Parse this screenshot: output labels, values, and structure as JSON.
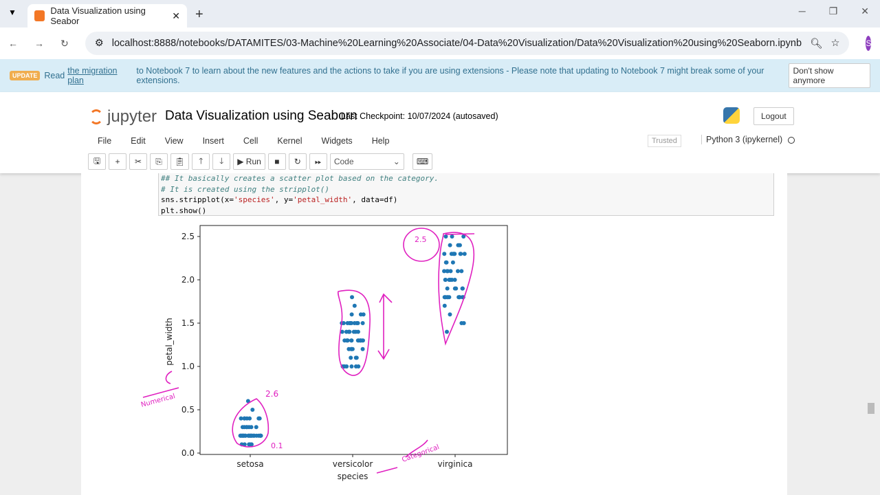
{
  "browser": {
    "tab_title": "Data Visualization using Seabor",
    "url": "localhost:8888/notebooks/DATAMITES/03-Machine%20Learning%20Associate/04-Data%20Visualization/Data%20Visualization%20using%20Seaborn.ipynb",
    "avatar": "S"
  },
  "banner": {
    "badge": "UPDATE",
    "pre": "Read",
    "link": "the migration plan",
    "post": "to Notebook 7 to learn about the new features and the actions to take if you are using extensions - Please note that updating to Notebook 7 might break some of your extensions.",
    "dismiss": "Don't show anymore"
  },
  "header": {
    "logo": "jupyter",
    "title": "Data Visualization using Seaborn",
    "checkpoint": "Last Checkpoint: 10/07/2024  (autosaved)",
    "logout": "Logout",
    "trusted": "Trusted",
    "kernel": "Python 3 (ipykernel)"
  },
  "menu": [
    "File",
    "Edit",
    "View",
    "Insert",
    "Cell",
    "Kernel",
    "Widgets",
    "Help"
  ],
  "toolbar": {
    "run": "Run",
    "cell_type": "Code"
  },
  "code": {
    "line1": "## It basically creates a scatter plot based on the category.",
    "line2": "# It is created using the stripplot()",
    "l3a": "sns.stripplot(x=",
    "l3b": "'species'",
    ",l3c": "",
    "l3sep": ", y=",
    "l3d": "'petal_width'",
    "l3e": ", data=df)",
    "line4": "plt.show()"
  },
  "chart_data": {
    "type": "scatter",
    "title": "",
    "xlabel": "species",
    "ylabel": "petal_width",
    "categories": [
      "setosa",
      "versicolor",
      "virginica"
    ],
    "ylim": [
      0,
      2.6
    ],
    "yticks": [
      "0.0",
      "0.5",
      "1.0",
      "1.5",
      "2.0",
      "2.5"
    ],
    "color": "#1f77b4",
    "series": [
      {
        "name": "setosa",
        "values": [
          0.1,
          0.1,
          0.1,
          0.1,
          0.1,
          0.2,
          0.2,
          0.2,
          0.2,
          0.2,
          0.2,
          0.2,
          0.2,
          0.2,
          0.2,
          0.2,
          0.2,
          0.2,
          0.2,
          0.2,
          0.2,
          0.2,
          0.2,
          0.2,
          0.2,
          0.2,
          0.2,
          0.2,
          0.2,
          0.2,
          0.2,
          0.2,
          0.2,
          0.2,
          0.3,
          0.3,
          0.3,
          0.3,
          0.3,
          0.3,
          0.3,
          0.4,
          0.4,
          0.4,
          0.4,
          0.4,
          0.4,
          0.4,
          0.5,
          0.6
        ]
      },
      {
        "name": "versicolor",
        "values": [
          1.0,
          1.0,
          1.0,
          1.0,
          1.0,
          1.0,
          1.0,
          1.1,
          1.1,
          1.1,
          1.2,
          1.2,
          1.2,
          1.2,
          1.2,
          1.3,
          1.3,
          1.3,
          1.3,
          1.3,
          1.3,
          1.3,
          1.3,
          1.3,
          1.3,
          1.3,
          1.3,
          1.3,
          1.4,
          1.4,
          1.4,
          1.4,
          1.4,
          1.4,
          1.4,
          1.5,
          1.5,
          1.5,
          1.5,
          1.5,
          1.5,
          1.5,
          1.5,
          1.5,
          1.5,
          1.6,
          1.6,
          1.6,
          1.7,
          1.8
        ]
      },
      {
        "name": "virginica",
        "values": [
          1.4,
          1.5,
          1.5,
          1.6,
          1.7,
          1.8,
          1.8,
          1.8,
          1.8,
          1.8,
          1.8,
          1.8,
          1.8,
          1.8,
          1.8,
          1.8,
          1.9,
          1.9,
          1.9,
          1.9,
          1.9,
          2.0,
          2.0,
          2.0,
          2.0,
          2.0,
          2.0,
          2.1,
          2.1,
          2.1,
          2.1,
          2.1,
          2.1,
          2.2,
          2.2,
          2.2,
          2.3,
          2.3,
          2.3,
          2.3,
          2.3,
          2.3,
          2.3,
          2.3,
          2.4,
          2.4,
          2.4,
          2.5,
          2.5,
          2.5
        ]
      }
    ],
    "annotations": [
      "2.5",
      "2.6",
      "0.1",
      "Numerical",
      "Categorical"
    ]
  }
}
